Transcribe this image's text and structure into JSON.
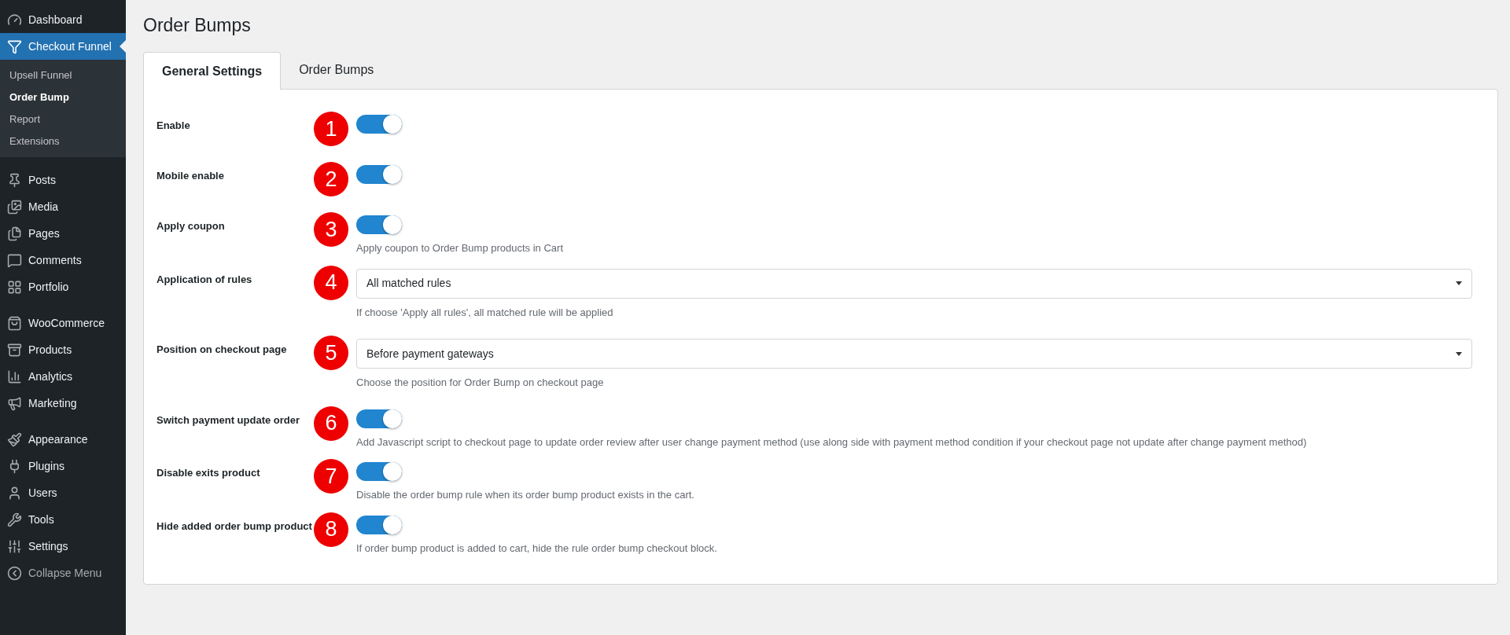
{
  "sidebar": {
    "groups": [
      {
        "items": [
          {
            "label": "Dashboard",
            "selected": false
          },
          {
            "label": "Checkout Funnel",
            "selected": true,
            "children": [
              {
                "label": "Upsell Funnel",
                "selected": false
              },
              {
                "label": "Order Bump",
                "selected": true
              },
              {
                "label": "Report",
                "selected": false
              },
              {
                "label": "Extensions",
                "selected": false
              }
            ]
          }
        ]
      },
      {
        "items": [
          {
            "label": "Posts",
            "selected": false
          },
          {
            "label": "Media",
            "selected": false
          },
          {
            "label": "Pages",
            "selected": false
          },
          {
            "label": "Comments",
            "selected": false
          },
          {
            "label": "Portfolio",
            "selected": false
          }
        ]
      },
      {
        "items": [
          {
            "label": "WooCommerce",
            "selected": false
          },
          {
            "label": "Products",
            "selected": false
          },
          {
            "label": "Analytics",
            "selected": false
          },
          {
            "label": "Marketing",
            "selected": false
          }
        ]
      },
      {
        "items": [
          {
            "label": "Appearance",
            "selected": false
          },
          {
            "label": "Plugins",
            "selected": false
          },
          {
            "label": "Users",
            "selected": false
          },
          {
            "label": "Tools",
            "selected": false
          },
          {
            "label": "Settings",
            "selected": false
          }
        ]
      }
    ],
    "collapse_label": "Collapse Menu"
  },
  "page_title": "Order Bumps",
  "tabs": [
    {
      "label": "General Settings",
      "selected": true
    },
    {
      "label": "Order Bumps",
      "selected": false
    }
  ],
  "settings": [
    {
      "kind": "toggle",
      "label": "Enable",
      "marker": "1",
      "on": true
    },
    {
      "kind": "toggle",
      "label": "Mobile enable",
      "marker": "2",
      "on": true
    },
    {
      "kind": "toggle",
      "label": "Apply coupon",
      "marker": "3",
      "on": true,
      "help": "Apply coupon to Order Bump products in Cart"
    },
    {
      "kind": "select",
      "label": "Application of rules",
      "marker": "4",
      "value": "All matched rules",
      "help": "If choose 'Apply all rules', all matched rule will be applied"
    },
    {
      "kind": "select",
      "label": "Position on checkout page",
      "marker": "5",
      "value": "Before payment gateways",
      "help": "Choose the position for Order Bump on checkout page"
    },
    {
      "kind": "toggle",
      "label": "Switch payment update order",
      "marker": "6",
      "on": true,
      "help": "Add Javascript script to checkout page to update order review after user change payment method (use along side with payment method condition if your checkout page not update after change payment method)"
    },
    {
      "kind": "toggle",
      "label": "Disable exits product",
      "marker": "7",
      "on": true,
      "help": "Disable the order bump rule when its order bump product exists in the cart."
    },
    {
      "kind": "toggle",
      "label": "Hide added order bump product",
      "marker": "8",
      "on": true,
      "help": "If order bump product is added to cart, hide the rule order bump checkout block."
    }
  ]
}
